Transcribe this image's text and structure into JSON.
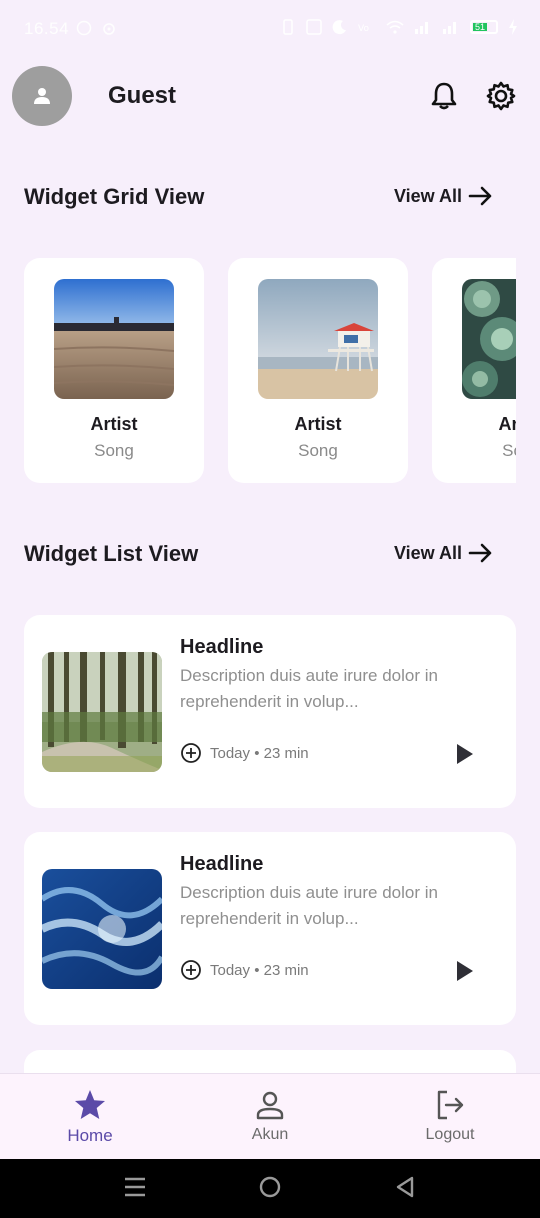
{
  "status_bar": {
    "time": "16.54",
    "battery_level": "51",
    "icons": [
      "whatsapp-icon",
      "sync-icon",
      "vibrate-icon",
      "nfc-icon",
      "moon-icon",
      "volte-icon",
      "wifi-icon",
      "signal-icon",
      "signal-icon",
      "battery-icon",
      "charging-icon"
    ]
  },
  "header": {
    "username": "Guest",
    "avatar_icon": "person-icon",
    "notification_icon": "bell-icon",
    "settings_icon": "gear-icon"
  },
  "grid_section": {
    "title": "Widget Grid View",
    "view_all": "View All",
    "items": [
      {
        "artist": "Artist",
        "song": "Song",
        "image": "beach-sand-photo"
      },
      {
        "artist": "Artist",
        "song": "Song",
        "image": "lifeguard-tower-photo"
      },
      {
        "artist": "Artist",
        "song": "Song",
        "image": "succulent-plants-photo"
      }
    ]
  },
  "list_section": {
    "title": "Widget List View",
    "view_all": "View All",
    "items": [
      {
        "headline": "Headline",
        "description": "Description duis aute irure dolor in reprehenderit in volup...",
        "meta": "Today • 23 min",
        "image": "forest-path-photo"
      },
      {
        "headline": "Headline",
        "description": "Description duis aute irure dolor in reprehenderit in volup...",
        "meta": "Today • 23 min",
        "image": "ocean-waves-photo"
      }
    ]
  },
  "bottom_nav": {
    "items": [
      {
        "label": "Home",
        "icon": "star-icon",
        "active": true
      },
      {
        "label": "Akun",
        "icon": "person-outline-icon",
        "active": false
      },
      {
        "label": "Logout",
        "icon": "logout-icon",
        "active": false
      }
    ]
  },
  "colors": {
    "background": "#f7effb",
    "card": "#ffffff",
    "accent": "#5b4aa8",
    "muted_text": "#8f8f8f"
  }
}
